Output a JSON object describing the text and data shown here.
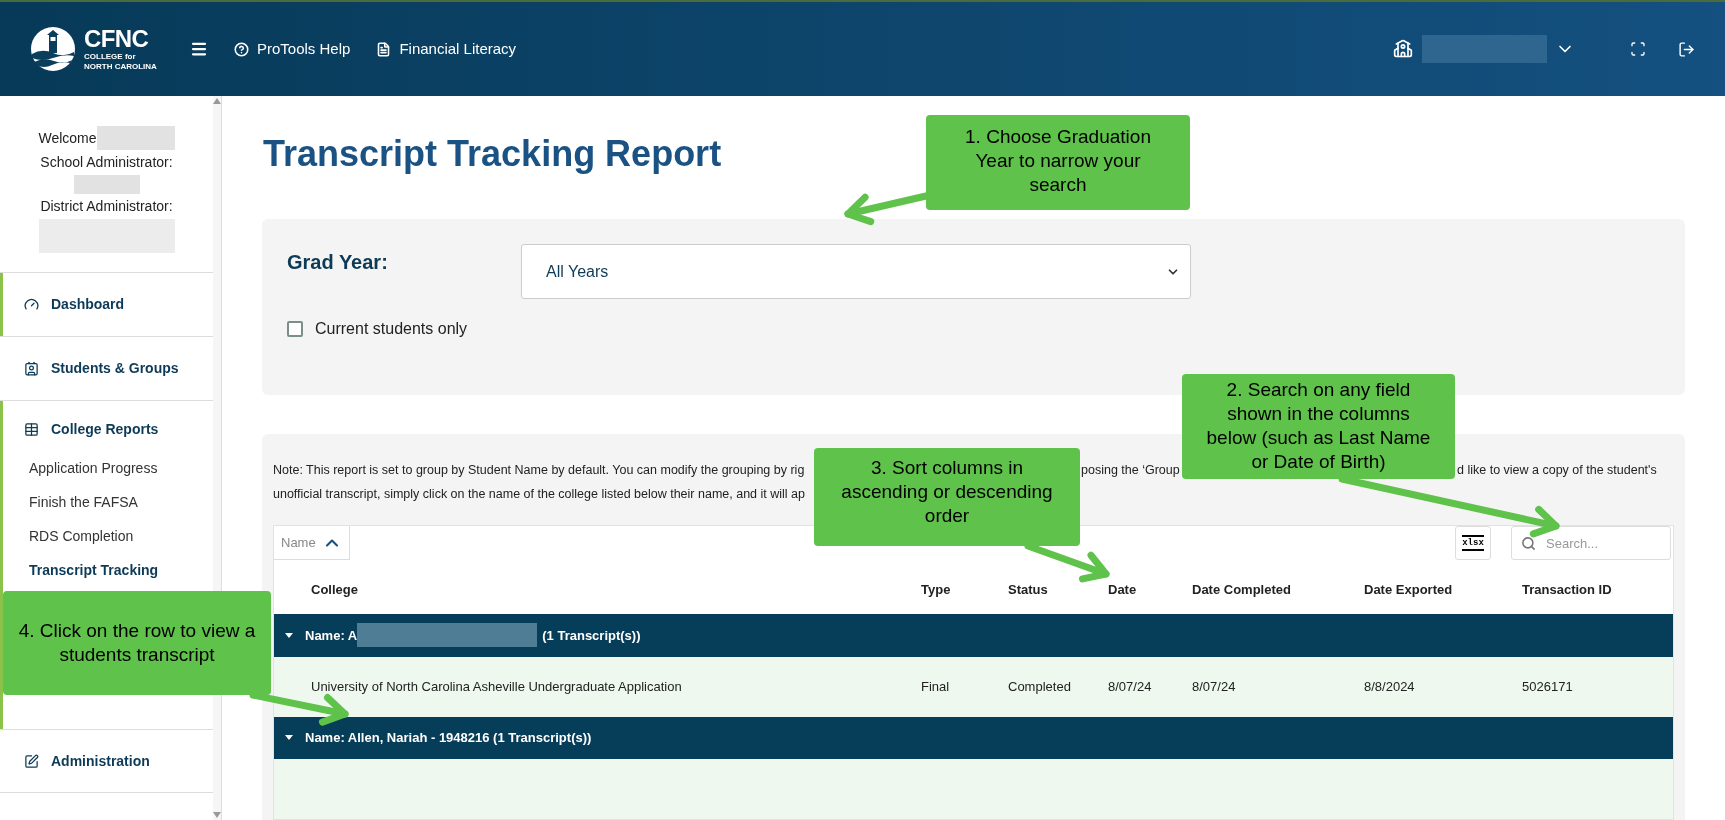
{
  "header": {
    "logo": {
      "mark": "CFNC",
      "line1": "COLLEGE for",
      "line2": "NORTH CAROLINA"
    },
    "nav": [
      {
        "kind": "help",
        "label": "ProTools Help"
      },
      {
        "kind": "document",
        "label": "Financial Literacy"
      }
    ]
  },
  "sidebar": {
    "welcome": "Welcome",
    "school_admin": "School Administrator:",
    "district_admin": "District Administrator:",
    "items": [
      {
        "kind": "section",
        "label": "Dashboard",
        "active": true
      },
      {
        "kind": "section",
        "label": "Students & Groups",
        "active": false
      },
      {
        "kind": "section",
        "label": "College Reports",
        "active": true
      },
      {
        "kind": "sub",
        "label": "Application Progress",
        "selected": false
      },
      {
        "kind": "sub",
        "label": "Finish the FAFSA",
        "selected": false
      },
      {
        "kind": "sub",
        "label": "RDS Completion",
        "selected": false
      },
      {
        "kind": "sub",
        "label": "Transcript Tracking",
        "selected": true
      },
      {
        "kind": "hidden"
      },
      {
        "kind": "section",
        "label": "Administration",
        "active": false
      }
    ]
  },
  "page_title": "Transcript Tracking Report",
  "filters": {
    "grad_year_label": "Grad Year:",
    "grad_year_value": "All Years",
    "current_students": {
      "label": "Current students only",
      "checked": false
    }
  },
  "report": {
    "note_line1": [
      "Note: This report is set to group by Student Name by default. You can modify the grouping by rig",
      "posing the ‘Group",
      "d like to view a copy of the student's"
    ],
    "note_line2": [
      "unofficial transcript, simply click on the name of the college listed below their name, and it will ap"
    ],
    "group_chip": "Name",
    "export_label": "xlsx",
    "search_placeholder": "Search...",
    "columns": [
      "College",
      "Type",
      "Status",
      "Date",
      "Date Completed",
      "Date Exported",
      "Transaction ID"
    ],
    "rows": [
      {
        "kind": "group",
        "expanded": true,
        "parts": [
          {
            "kind": "text",
            "text": "Name: A"
          },
          {
            "kind": "redacted"
          },
          {
            "kind": "text",
            "text": "(1 Transcript(s))"
          }
        ]
      },
      {
        "kind": "record",
        "cells": [
          "University of North Carolina Asheville Undergraduate Application",
          "Final",
          "Completed",
          "8/07/24",
          "8/07/24",
          "8/8/2024",
          "5026171"
        ]
      },
      {
        "kind": "group",
        "expanded": true,
        "parts": [
          {
            "kind": "text",
            "text": "Name: Allen, Nariah - 1948216 (1 Transcript(s))"
          }
        ]
      },
      {
        "kind": "record",
        "cells": []
      }
    ]
  },
  "callouts": [
    "1. Choose Graduation Year to narrow your search",
    "2. Search on any field shown in the columns below (such as Last Name or Date of Birth)",
    "3. Sort columns in ascending or descending order",
    "4. Click on the row to view a students transcript"
  ]
}
